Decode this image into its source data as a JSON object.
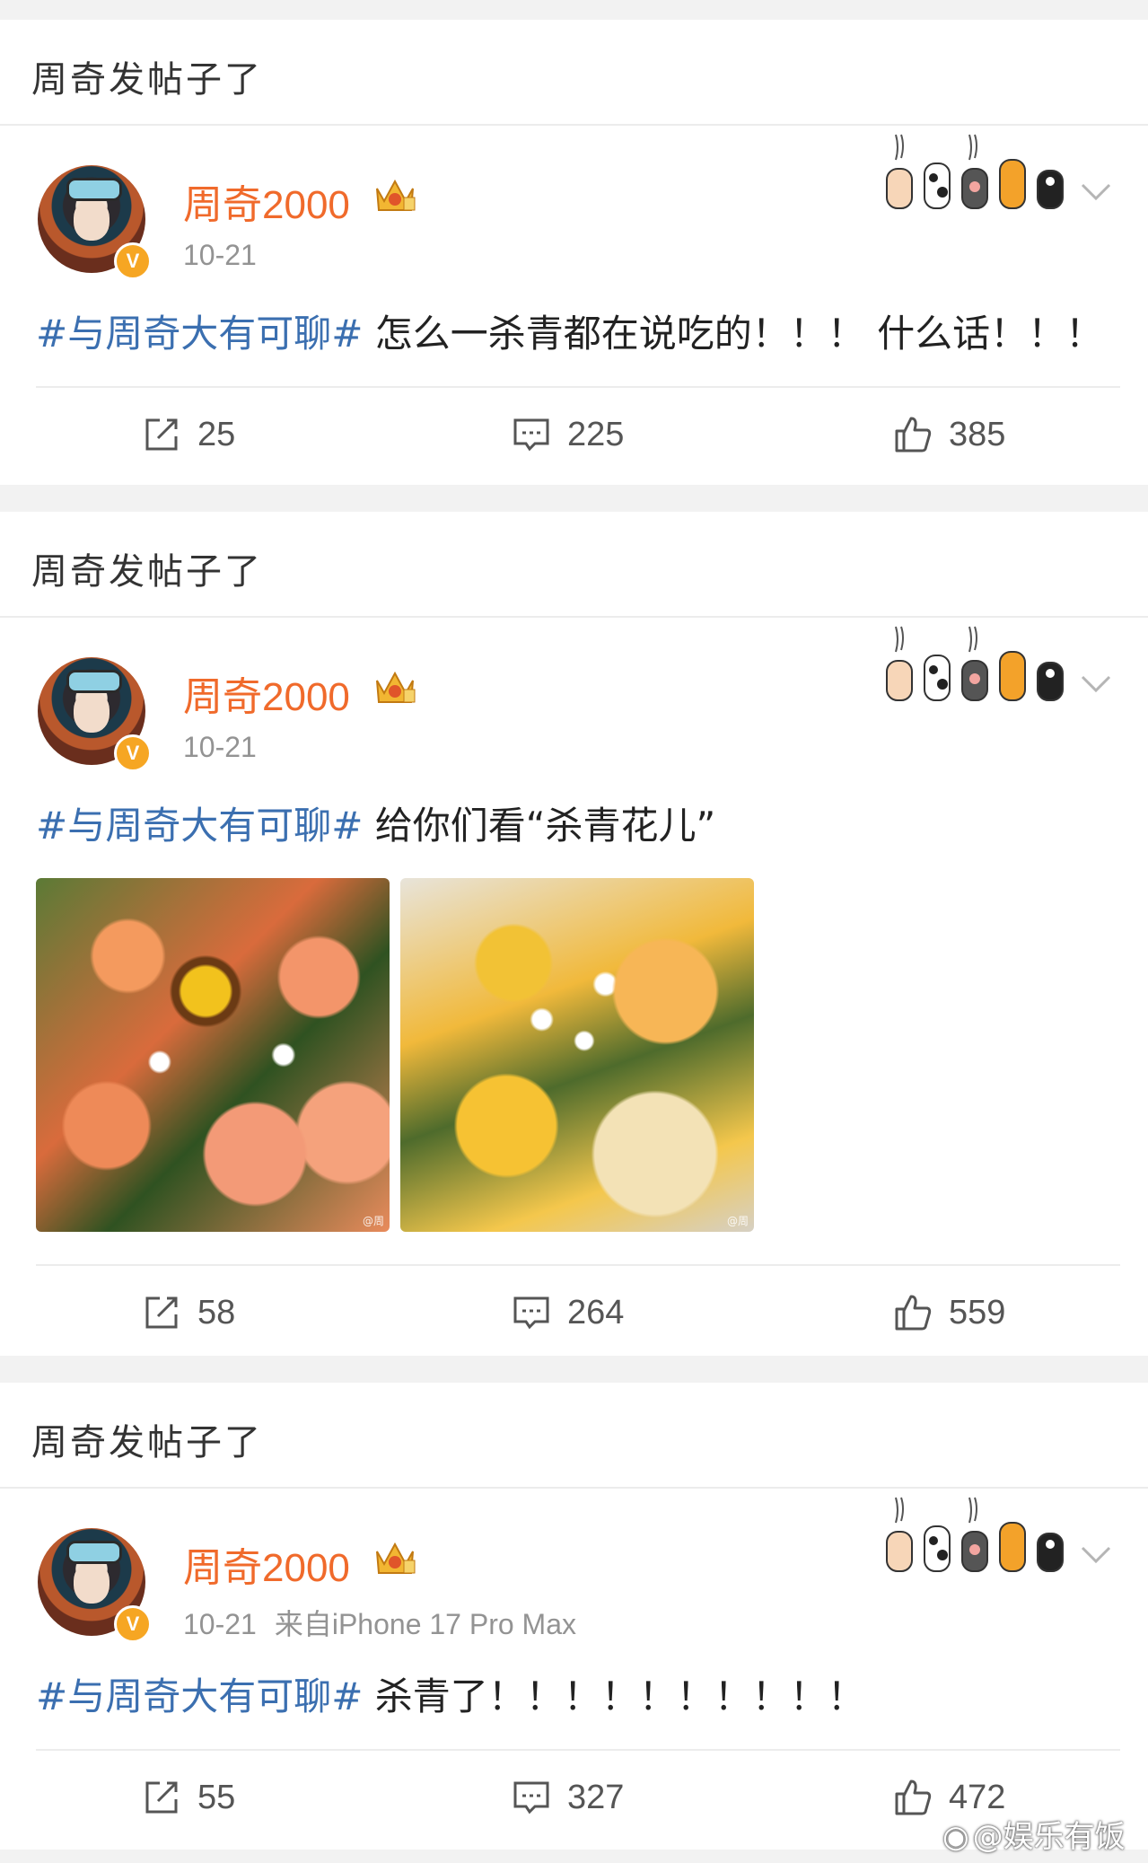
{
  "posts": [
    {
      "header_title": "周奇发帖子了",
      "username": "周奇2000",
      "date": "10-21",
      "source": "",
      "topic": "#与周奇大有可聊#",
      "text": " 怎么一杀青都在说吃的！！！ 什么话！！！",
      "has_images": false,
      "reposts": "25",
      "comments": "225",
      "likes": "385"
    },
    {
      "header_title": "周奇发帖子了",
      "username": "周奇2000",
      "date": "10-21",
      "source": "",
      "topic": "#与周奇大有可聊#",
      "text": " 给你们看“杀青花儿”",
      "has_images": true,
      "image_watermarks": [
        "@周",
        "@周"
      ],
      "reposts": "58",
      "comments": "264",
      "likes": "559"
    },
    {
      "header_title": "周奇发帖子了",
      "username": "周奇2000",
      "date": "10-21",
      "source": "来自iPhone 17 Pro Max",
      "topic": "#与周奇大有可聊#",
      "text": " 杀青了！！！！！！！！！！",
      "has_images": false,
      "reposts": "55",
      "comments": "327",
      "likes": "472"
    }
  ],
  "icons": {
    "verified": "verified-v-badge",
    "crown": "crown-icon",
    "paws": "cat-paws-decoration",
    "menu": "chevron-down-icon",
    "repost": "repost-icon",
    "comment": "comment-icon",
    "like": "thumbs-up-icon"
  },
  "colors": {
    "username": "#f06a2b",
    "topic": "#3b6fb0",
    "verified": "#f6a623",
    "background": "#f2f2f2"
  },
  "watermark": {
    "text": "@娱乐有饭"
  }
}
